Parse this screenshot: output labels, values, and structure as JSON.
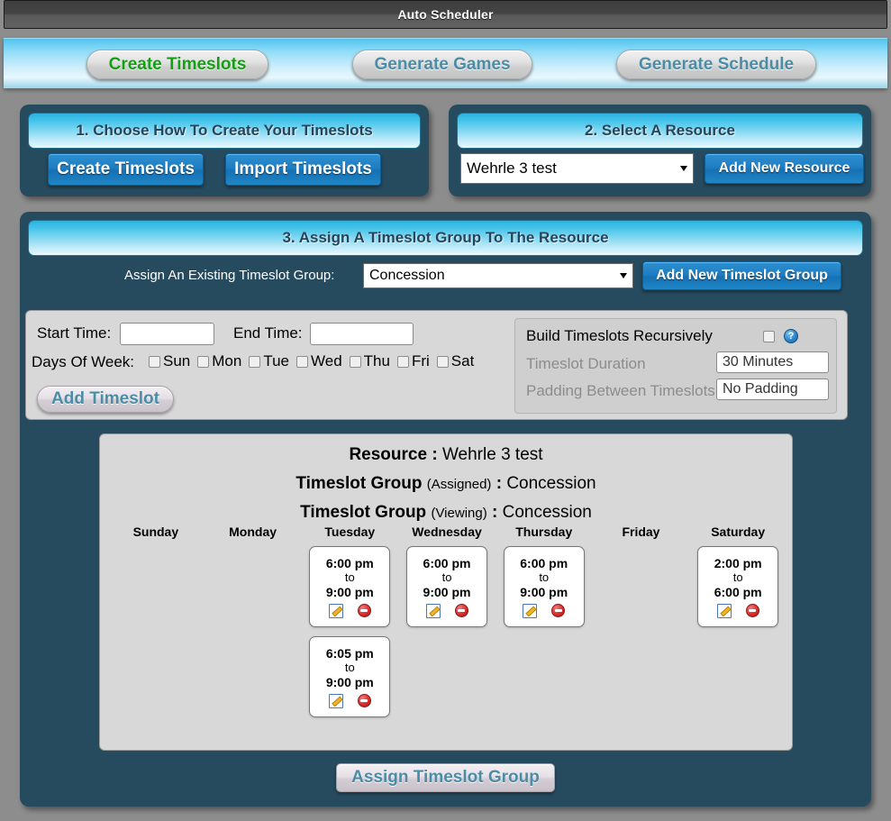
{
  "window": {
    "title": "Auto Scheduler"
  },
  "nav": {
    "tabs": [
      {
        "label": "Create Timeslots",
        "active": true,
        "color": "#13a013"
      },
      {
        "label": "Generate Games",
        "active": false,
        "color": "#4b8da6"
      },
      {
        "label": "Generate Schedule",
        "active": false,
        "color": "#4b8da6"
      }
    ]
  },
  "panel1": {
    "title": "1. Choose How To Create Your Timeslots",
    "buttons": [
      {
        "label": "Create Timeslots"
      },
      {
        "label": "Import Timeslots"
      }
    ]
  },
  "panel2": {
    "title": "2. Select A Resource",
    "resource_select": {
      "value": "Wehrle 3 test"
    },
    "add_button": {
      "label": "Add New Resource"
    }
  },
  "panel3": {
    "title": "3. Assign A Timeslot Group To The Resource",
    "assign_label": "Assign An Existing Timeslot Group:",
    "group_select": {
      "value": "Concession"
    },
    "add_group_button": {
      "label": "Add New Timeslot Group"
    }
  },
  "form": {
    "start_label": "Start Time:",
    "start_value": "",
    "end_label": "End Time:",
    "end_value": "",
    "days_label": "Days Of Week:",
    "days": [
      {
        "label": "Sun",
        "checked": false
      },
      {
        "label": "Mon",
        "checked": false
      },
      {
        "label": "Tue",
        "checked": false
      },
      {
        "label": "Wed",
        "checked": false
      },
      {
        "label": "Thu",
        "checked": false
      },
      {
        "label": "Fri",
        "checked": false
      },
      {
        "label": "Sat",
        "checked": false
      }
    ],
    "add_timeslot_button": {
      "label": "Add Timeslot"
    }
  },
  "recursive": {
    "title": "Build Timeslots Recursively",
    "checked": false,
    "help_icon": "help-icon",
    "help_glyph": "?",
    "duration_label": "Timeslot Duration",
    "duration_value": "30 Minutes",
    "padding_label": "Padding Between Timeslots",
    "padding_value": "No Padding",
    "disabled": true
  },
  "calendar": {
    "resource_key": "Resource",
    "resource_value": "Wehrle 3 test",
    "group_assigned_key": "Timeslot Group",
    "group_assigned_sub": "(Assigned)",
    "group_assigned_value": "Concession",
    "group_viewing_key": "Timeslot Group",
    "group_viewing_sub": "(Viewing)",
    "group_viewing_value": "Concession",
    "separator": " : ",
    "days": [
      {
        "name": "Sunday",
        "slots": []
      },
      {
        "name": "Monday",
        "slots": []
      },
      {
        "name": "Tuesday",
        "slots": [
          {
            "start": "6:00 pm",
            "to": "to",
            "end": "9:00 pm"
          },
          {
            "start": "6:05 pm",
            "to": "to",
            "end": "9:00 pm"
          }
        ]
      },
      {
        "name": "Wednesday",
        "slots": [
          {
            "start": "6:00 pm",
            "to": "to",
            "end": "9:00 pm"
          }
        ]
      },
      {
        "name": "Thursday",
        "slots": [
          {
            "start": "6:00 pm",
            "to": "to",
            "end": "9:00 pm"
          }
        ]
      },
      {
        "name": "Friday",
        "slots": []
      },
      {
        "name": "Saturday",
        "slots": [
          {
            "start": "2:00 pm",
            "to": "to",
            "end": "6:00 pm"
          }
        ]
      }
    ]
  },
  "footer": {
    "assign_button": {
      "label": "Assign Timeslot Group"
    }
  }
}
